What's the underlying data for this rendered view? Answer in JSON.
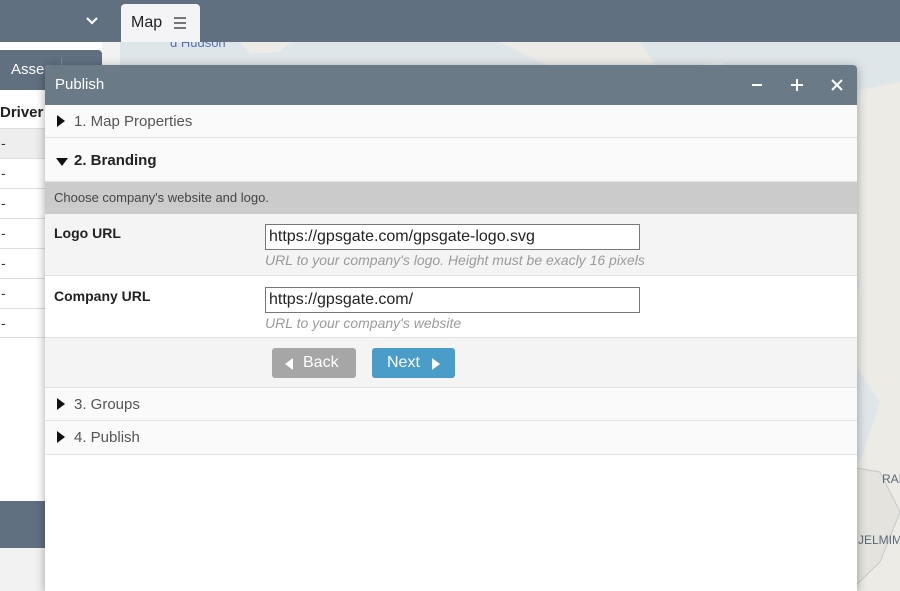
{
  "app": {
    "map_tab_label": "Map",
    "assets_tab_label": "Asse",
    "driver_column_header": "Driver",
    "driver_rows": [
      "-",
      "-",
      "-",
      "-",
      "-",
      "-",
      "-"
    ]
  },
  "map": {
    "labels": [
      "d Hudson",
      "RAI",
      "JELMIM-"
    ]
  },
  "dialog": {
    "title": "Publish",
    "sections": [
      {
        "label": "1. Map Properties",
        "expanded": false
      },
      {
        "label": "2. Branding",
        "expanded": true
      },
      {
        "label": "3. Groups",
        "expanded": false
      },
      {
        "label": "4. Publish",
        "expanded": false
      }
    ],
    "branding": {
      "description": "Choose company's website and logo.",
      "logo_url": {
        "label": "Logo URL",
        "value": "https://gpsgate.com/gpsgate-logo.svg",
        "hint": "URL to your company's logo. Height must be exacly 16 pixels"
      },
      "company_url": {
        "label": "Company URL",
        "value": "https://gpsgate.com/",
        "hint": "URL to your company's website"
      },
      "back_label": "Back",
      "next_label": "Next"
    }
  },
  "colors": {
    "header": "#6a7a87",
    "topbar": "#607080",
    "next_button": "#4a9cc9",
    "back_button": "#a6a6a6"
  }
}
